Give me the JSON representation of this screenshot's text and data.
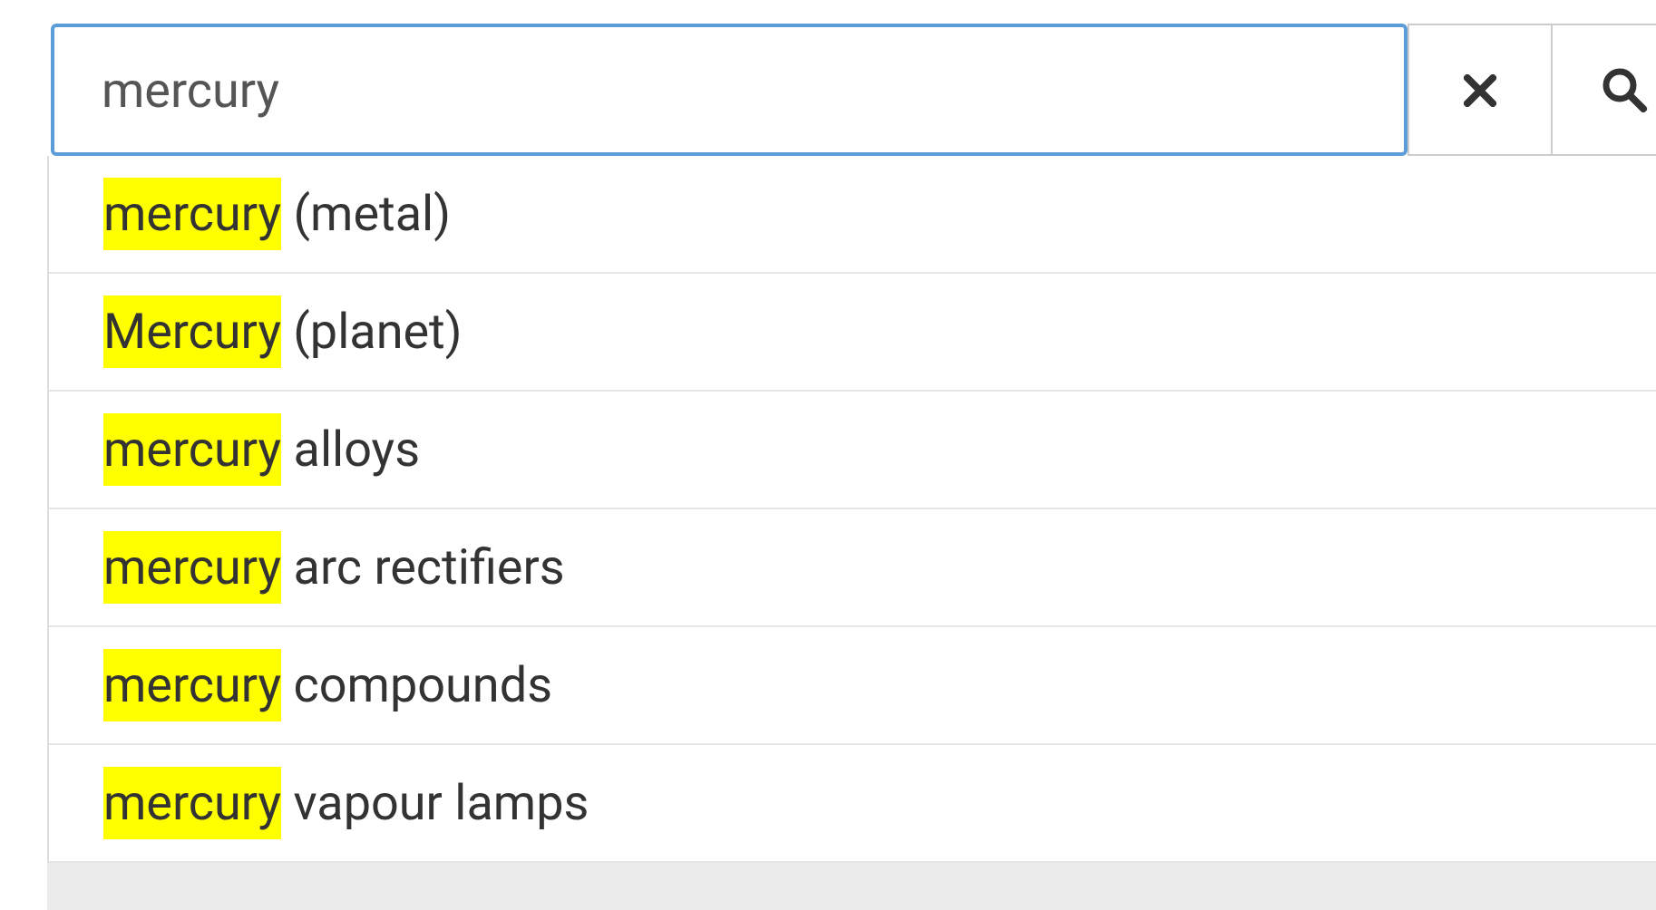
{
  "search": {
    "value": "mercury"
  },
  "suggestions": [
    {
      "match": "mercury",
      "rest": " (metal)"
    },
    {
      "match": "Mercury",
      "rest": " (planet)"
    },
    {
      "match": "mercury",
      "rest": " alloys"
    },
    {
      "match": "mercury",
      "rest": " arc rectifiers"
    },
    {
      "match": "mercury",
      "rest": " compounds"
    },
    {
      "match": "mercury",
      "rest": " vapour lamps"
    }
  ]
}
